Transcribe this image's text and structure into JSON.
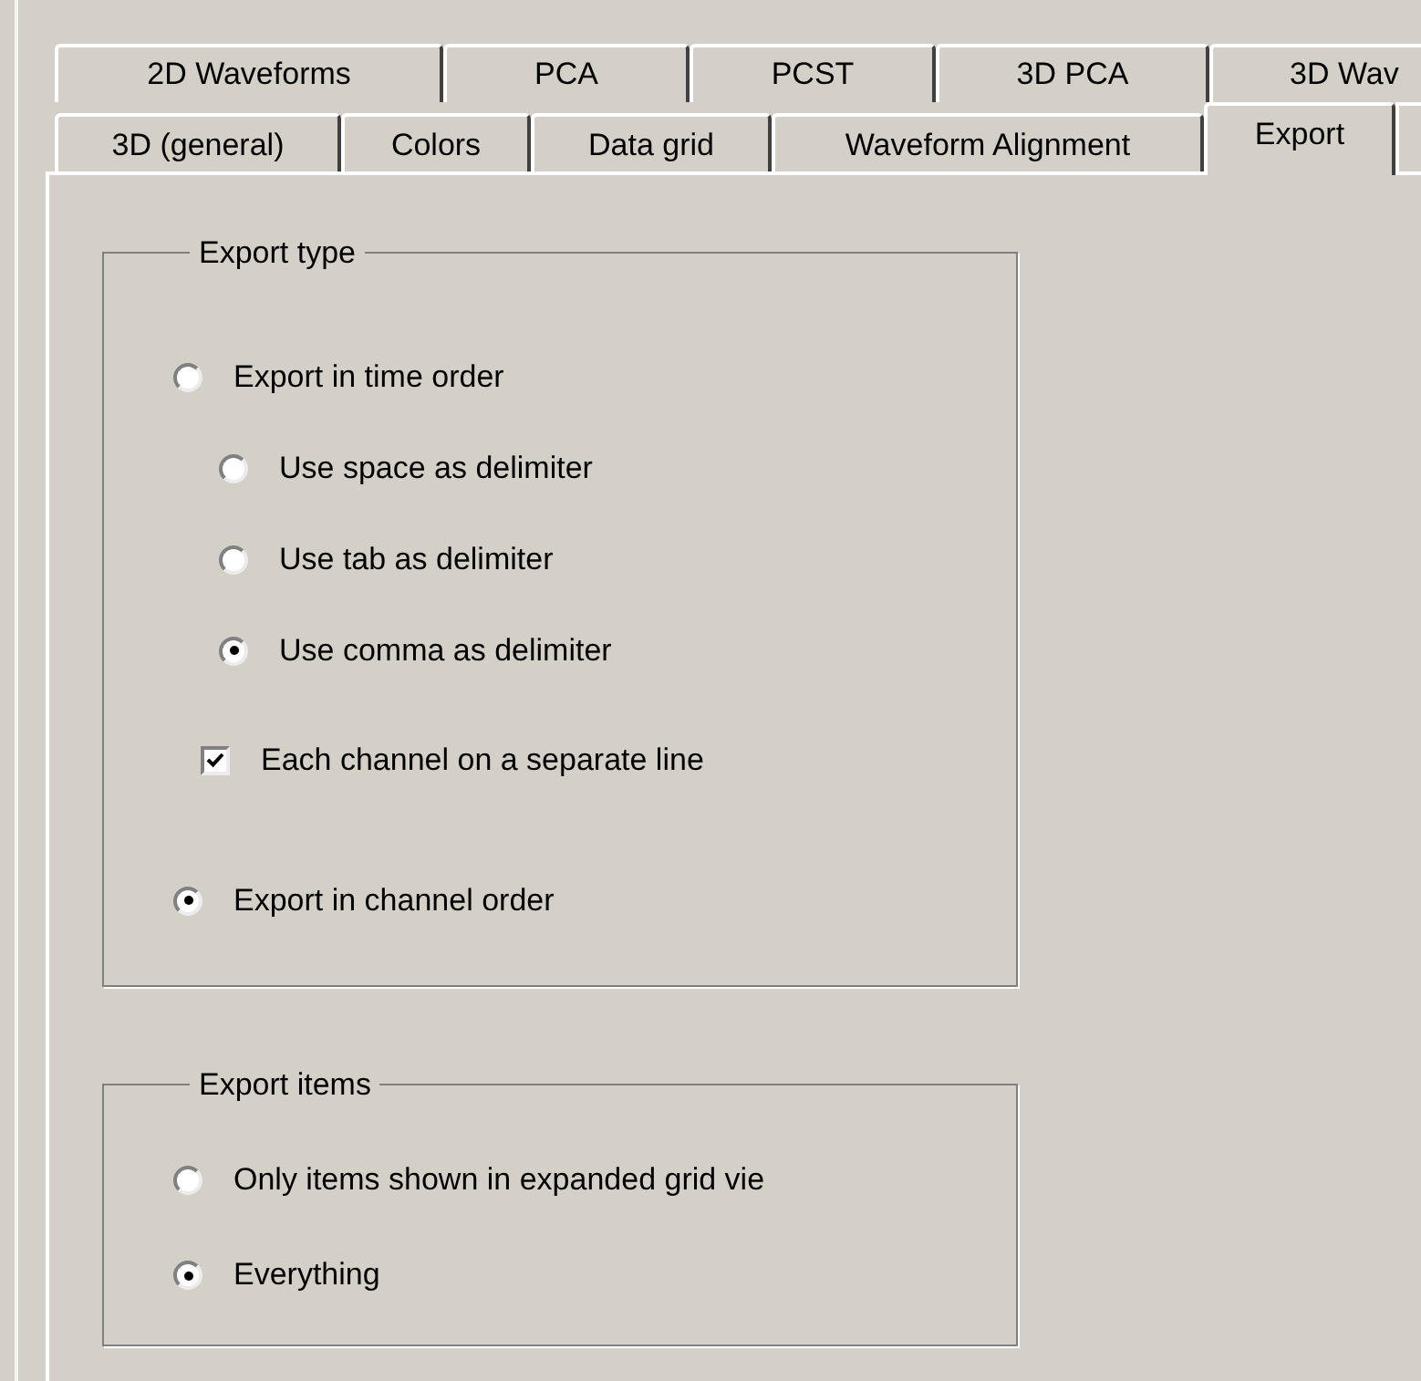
{
  "tab_rows": [
    {
      "tabs": [
        {
          "label": "2D Waveforms",
          "selected": false
        },
        {
          "label": "PCA",
          "selected": false
        },
        {
          "label": "PCST",
          "selected": false
        },
        {
          "label": "3D PCA",
          "selected": false
        },
        {
          "label": "3D Wav",
          "selected": false
        }
      ]
    },
    {
      "tabs": [
        {
          "label": "3D (general)",
          "selected": false
        },
        {
          "label": "Colors",
          "selected": false
        },
        {
          "label": "Data grid",
          "selected": false
        },
        {
          "label": "Waveform Alignment",
          "selected": false
        },
        {
          "label": "Export",
          "selected": true
        }
      ]
    }
  ],
  "groups": [
    {
      "title": "Export type",
      "options": [
        {
          "kind": "radio",
          "label": "Export in time order",
          "selected": false,
          "children": [
            {
              "kind": "radio",
              "label": "Use space as delimiter",
              "selected": false
            },
            {
              "kind": "radio",
              "label": "Use tab as delimiter",
              "selected": false
            },
            {
              "kind": "radio",
              "label": "Use comma as delimiter",
              "selected": true
            },
            {
              "kind": "checkbox",
              "label": "Each channel on a separate line",
              "checked": true
            }
          ]
        },
        {
          "kind": "radio",
          "label": "Export in channel order",
          "selected": true
        }
      ]
    },
    {
      "title": "Export items",
      "options": [
        {
          "kind": "radio",
          "label": "Only items shown in expanded grid vie",
          "selected": false
        },
        {
          "kind": "radio",
          "label": "Everything",
          "selected": true
        }
      ]
    }
  ]
}
